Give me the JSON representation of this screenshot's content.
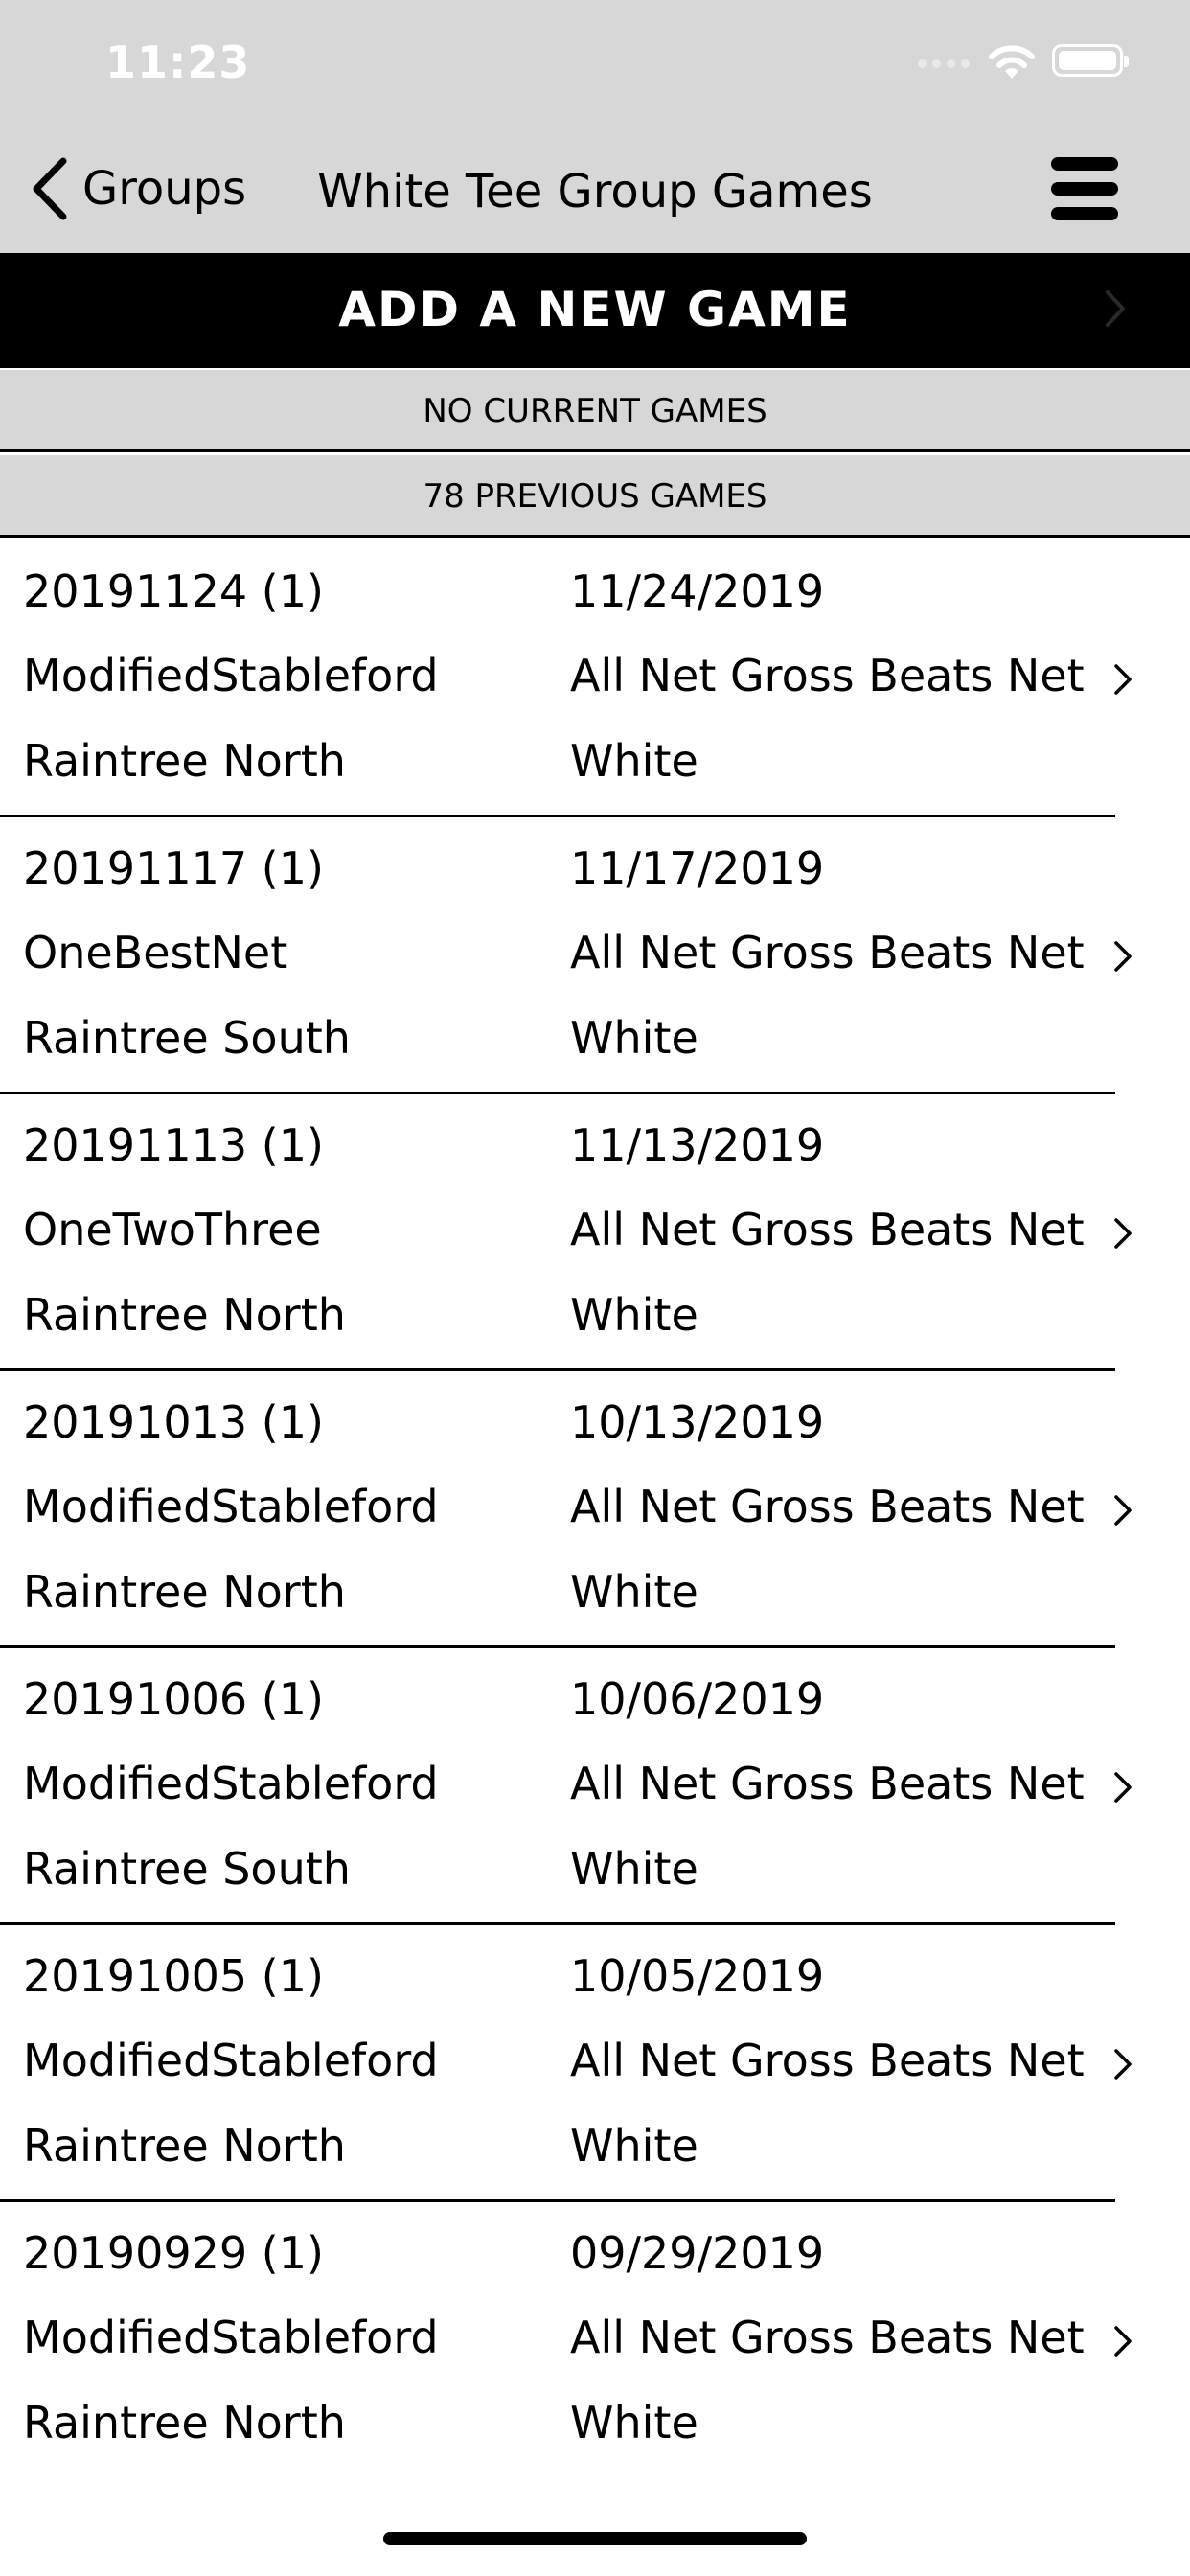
{
  "status_bar": {
    "time": "11:23"
  },
  "nav": {
    "back_label": "Groups",
    "title": "White Tee Group Games"
  },
  "add_game_label": "ADD A NEW GAME",
  "sections": {
    "current_label": "NO CURRENT GAMES",
    "previous_label": "78 PREVIOUS GAMES"
  },
  "games": [
    {
      "name": "20191124 (1)",
      "date": "11/24/2019",
      "format": "ModifiedStableford",
      "scoring": "All Net Gross Beats Net",
      "course": "Raintree North",
      "tee": "White"
    },
    {
      "name": "20191117 (1)",
      "date": "11/17/2019",
      "format": "OneBestNet",
      "scoring": "All Net Gross Beats Net",
      "course": "Raintree South",
      "tee": "White"
    },
    {
      "name": "20191113 (1)",
      "date": "11/13/2019",
      "format": "OneTwoThree",
      "scoring": "All Net Gross Beats Net",
      "course": "Raintree North",
      "tee": "White"
    },
    {
      "name": "20191013 (1)",
      "date": "10/13/2019",
      "format": "ModifiedStableford",
      "scoring": "All Net Gross Beats Net",
      "course": "Raintree North",
      "tee": "White"
    },
    {
      "name": "20191006 (1)",
      "date": "10/06/2019",
      "format": "ModifiedStableford",
      "scoring": "All Net Gross Beats Net",
      "course": "Raintree South",
      "tee": "White"
    },
    {
      "name": "20191005 (1)",
      "date": "10/05/2019",
      "format": "ModifiedStableford",
      "scoring": "All Net Gross Beats Net",
      "course": "Raintree North",
      "tee": "White"
    },
    {
      "name": "20190929 (1)",
      "date": "09/29/2019",
      "format": "ModifiedStableford",
      "scoring": "All Net Gross Beats Net",
      "course": "Raintree North",
      "tee": "White"
    }
  ]
}
